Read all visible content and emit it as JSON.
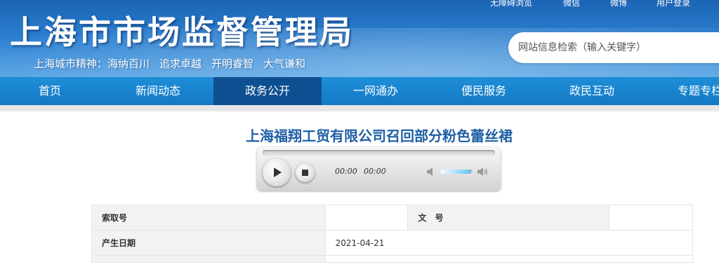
{
  "header": {
    "site_title": "上海市市场监督管理局",
    "spirit_label": "上海城市精神：",
    "spirit_items": [
      "海纳百川",
      "追求卓越",
      "开明睿智",
      "大气谦和"
    ],
    "top_links": [
      "无障碍浏览",
      "微信",
      "微博",
      "用户登录"
    ],
    "search_placeholder": "网站信息检索（输入关键字）"
  },
  "nav": {
    "items": [
      "首页",
      "新闻动态",
      "政务公开",
      "一网通办",
      "便民服务",
      "政民互动",
      "专题专栏"
    ],
    "active": "政务公开"
  },
  "article": {
    "title": "上海福翔工贸有限公司召回部分粉色蕾丝裙"
  },
  "player": {
    "current_time": "00:00",
    "duration": "00:00",
    "volume_level": 0.95
  },
  "meta": {
    "index_label": "索取号",
    "index_value": "",
    "doc_no_label": "文号",
    "doc_no_value": "",
    "date_label": "产生日期",
    "date_value": "2021-04-21"
  },
  "colors": {
    "banner": "#2a7dce",
    "nav": "#1884cf",
    "nav_active": "#0e4f92",
    "title": "#1f5fa5"
  }
}
